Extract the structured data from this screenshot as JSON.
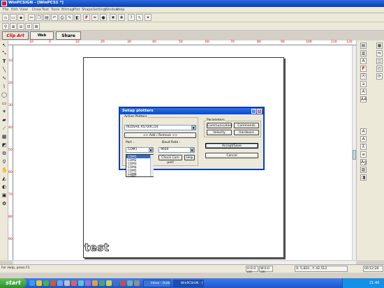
{
  "window": {
    "title": "WinPCSIGN - [WinPCS1 *]"
  },
  "menu": [
    "File",
    "Edit",
    "View",
    "Draw",
    "Text",
    "Tools",
    "Bitmap",
    "Plot",
    "Shape",
    "Setting",
    "Window",
    "Help"
  ],
  "tabs": {
    "clipart": "Clip Art",
    "webclipart": "Web ClipArt",
    "sharelogo": "Share Logo"
  },
  "ruler": {
    "h": [
      "10",
      "0",
      "10",
      "20",
      "30",
      "40",
      "50",
      "60",
      "70",
      "80",
      "90",
      "100",
      "110",
      "120"
    ],
    "v": [
      "10",
      "20",
      "30",
      "40",
      "50",
      "60",
      "70",
      "80",
      "90"
    ]
  },
  "canvas": {
    "text": "test"
  },
  "status": {
    "help": "For Help, press F1",
    "h": "H:0.0 cm",
    "w": "W:0.0 cm",
    "xy": "X: 5.810 , Y: 42.513",
    "coords": "00:12:28"
  },
  "taskbar": {
    "start": "start",
    "tasks": [
      "Inbox - Outlook E...",
      "WinPCSIGN - [WinPC..."
    ],
    "clock": "21:40"
  },
  "dialog": {
    "title": "Setup plotters",
    "help_btn": "?",
    "close_btn": "X",
    "active_group": "Active Plotters",
    "plotter_value": "REDSAIL RS720C/24",
    "add_remove": "<< Add / Remove >>",
    "port_label": "Port :",
    "port_value": "COM1",
    "port_options": [
      "COM1",
      "COM2",
      "COM3",
      "COM4",
      "COM5",
      "COM6",
      "COM7"
    ],
    "baud_label": "Baud Rate :",
    "baud_value": "9600",
    "check_com": "Check Com port",
    "help": "Help",
    "params_group": "Parameters",
    "communication": "Communication",
    "commands": "Commands",
    "velocity": "Velocity",
    "hardware": "Hardware",
    "accept_save": "Accept/Save",
    "cancel": "Cancel"
  }
}
